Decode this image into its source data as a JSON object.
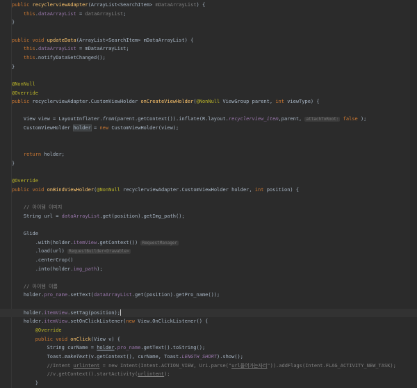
{
  "editor": {
    "lines": [
      [
        {
          "t": "public ",
          "c": "kw"
        },
        {
          "t": "recyclerviewAdapter",
          "c": "fn"
        },
        {
          "t": "(ArrayList<SearchItem> "
        },
        {
          "t": "mDataArrayList",
          "c": "cmt"
        },
        {
          "t": ") {"
        }
      ],
      [
        {
          "t": "    "
        },
        {
          "t": "this",
          "c": "kw"
        },
        {
          "t": "."
        },
        {
          "t": "dataArrayList",
          "c": "fld"
        },
        {
          "t": " = "
        },
        {
          "t": "dataArrayList",
          "c": "cmt"
        },
        {
          "t": ";"
        }
      ],
      [
        {
          "t": "}"
        }
      ],
      [],
      [
        {
          "t": "public void ",
          "c": "kw"
        },
        {
          "t": "updateData",
          "c": "fn"
        },
        {
          "t": "(ArrayList<SearchItem> mDataArrayList) {"
        }
      ],
      [
        {
          "t": "    "
        },
        {
          "t": "this",
          "c": "kw"
        },
        {
          "t": "."
        },
        {
          "t": "dataArrayList",
          "c": "fld"
        },
        {
          "t": " = mDataArrayList;"
        }
      ],
      [
        {
          "t": "    "
        },
        {
          "t": "this",
          "c": "kw"
        },
        {
          "t": ".notifyDataSetChanged();"
        }
      ],
      [
        {
          "t": "}"
        }
      ],
      [],
      [
        {
          "t": "@NonNull",
          "c": "ann"
        }
      ],
      [
        {
          "t": "@Override",
          "c": "ann"
        }
      ],
      [
        {
          "t": "public ",
          "c": "kw"
        },
        {
          "t": "recyclerviewAdapter.CustomViewHolder "
        },
        {
          "t": "onCreateViewHolder",
          "c": "fn"
        },
        {
          "t": "("
        },
        {
          "t": "@NonNull ",
          "c": "ann"
        },
        {
          "t": "ViewGroup parent, "
        },
        {
          "t": "int ",
          "c": "kw"
        },
        {
          "t": "viewType) {"
        }
      ],
      [],
      [
        {
          "t": "    View view = LayoutInflater."
        },
        {
          "t": "from",
          "c": "ita"
        },
        {
          "t": "(parent.getContext()).inflate(R.layout."
        },
        {
          "t": "recyclerview_item",
          "c": "fld ita"
        },
        {
          "t": ",parent, "
        },
        {
          "t": "attachToRoot:",
          "c": "hint"
        },
        {
          "t": " "
        },
        {
          "t": "false",
          "c": "kw"
        },
        {
          "t": " );"
        }
      ],
      [
        {
          "t": "    CustomViewHolder "
        },
        {
          "t": "holder",
          "c": "hl"
        },
        {
          "t": " = "
        },
        {
          "t": "new ",
          "c": "kw"
        },
        {
          "t": "CustomViewHolder(view);"
        }
      ],
      [],
      [],
      [
        {
          "t": "    "
        },
        {
          "t": "return ",
          "c": "kw"
        },
        {
          "t": "holder;"
        }
      ],
      [
        {
          "t": "}"
        }
      ],
      [],
      [
        {
          "t": "@Override",
          "c": "ann"
        }
      ],
      [
        {
          "t": "public void ",
          "c": "kw"
        },
        {
          "t": "onBindViewHolder",
          "c": "fn"
        },
        {
          "t": "("
        },
        {
          "t": "@NonNull ",
          "c": "ann"
        },
        {
          "t": "recyclerviewAdapter.CustomViewHolder holder, "
        },
        {
          "t": "int ",
          "c": "kw"
        },
        {
          "t": "position) {"
        }
      ],
      [],
      [
        {
          "t": "    // 아이템 이미지",
          "c": "cmt"
        }
      ],
      [
        {
          "t": "    String url = "
        },
        {
          "t": "dataArrayList",
          "c": "fld"
        },
        {
          "t": ".get(position).getImg_path();"
        }
      ],
      [],
      [
        {
          "t": "    Glide"
        }
      ],
      [
        {
          "t": "        .with(holder."
        },
        {
          "t": "itemView",
          "c": "fld"
        },
        {
          "t": ".getContext()) "
        },
        {
          "t": "RequestManager",
          "c": "hint"
        }
      ],
      [
        {
          "t": "        .load(url) "
        },
        {
          "t": "RequestBuilder<Drawable>",
          "c": "hint"
        }
      ],
      [
        {
          "t": "        .centerCrop()"
        }
      ],
      [
        {
          "t": "        .into(holder."
        },
        {
          "t": "img_path",
          "c": "fld"
        },
        {
          "t": ");"
        }
      ],
      [],
      [
        {
          "t": "    // 아이템 이름",
          "c": "cmt"
        }
      ],
      [
        {
          "t": "    holder."
        },
        {
          "t": "pro_name",
          "c": "fld"
        },
        {
          "t": ".setText("
        },
        {
          "t": "dataArrayList",
          "c": "fld"
        },
        {
          "t": ".get(position).getPro_name());"
        }
      ],
      [],
      [
        {
          "t": "    holder."
        },
        {
          "t": "itemView",
          "c": "fld"
        },
        {
          "t": ".setTag(position);"
        },
        {
          "caret": true
        }
      ],
      [
        {
          "t": "    holder."
        },
        {
          "t": "itemView",
          "c": "fld"
        },
        {
          "t": ".setOnClickListener("
        },
        {
          "t": "new ",
          "c": "kw"
        },
        {
          "t": "View.OnClickListener() {"
        }
      ],
      [
        {
          "t": "        "
        },
        {
          "t": "@Override",
          "c": "ann"
        }
      ],
      [
        {
          "t": "        "
        },
        {
          "t": "public void ",
          "c": "kw"
        },
        {
          "t": "onClick",
          "c": "fn"
        },
        {
          "t": "(View v) {"
        }
      ],
      [
        {
          "t": "            String curName = "
        },
        {
          "t": "holder",
          "c": "ref"
        },
        {
          "t": "."
        },
        {
          "t": "pro_name",
          "c": "fld"
        },
        {
          "t": ".getText().toString();"
        }
      ],
      [
        {
          "t": "            Toast."
        },
        {
          "t": "makeText",
          "c": "ita"
        },
        {
          "t": "(v.getContext(), curName, Toast."
        },
        {
          "t": "LENGTH_SHORT",
          "c": "fld ita"
        },
        {
          "t": ").show();"
        }
      ],
      [
        {
          "t": "            //Intent ",
          "c": "cmt"
        },
        {
          "t": "urlintent",
          "c": "cmt ref"
        },
        {
          "t": " = new Intent(Intent.ACTION_VIEW, Uri.parse(\"",
          "c": "cmt"
        },
        {
          "t": "url들어가는자리",
          "c": "cmt ref"
        },
        {
          "t": "\")).addFlags(Intent.FLAG_ACTIVITY_NEW_TASK);",
          "c": "cmt"
        }
      ],
      [
        {
          "t": "            //v.getContext().startActivity(",
          "c": "cmt"
        },
        {
          "t": "urlintent",
          "c": "cmt ref"
        },
        {
          "t": ");",
          "c": "cmt"
        }
      ],
      [
        {
          "t": "        }"
        }
      ],
      [
        {
          "t": "    });"
        }
      ]
    ]
  }
}
